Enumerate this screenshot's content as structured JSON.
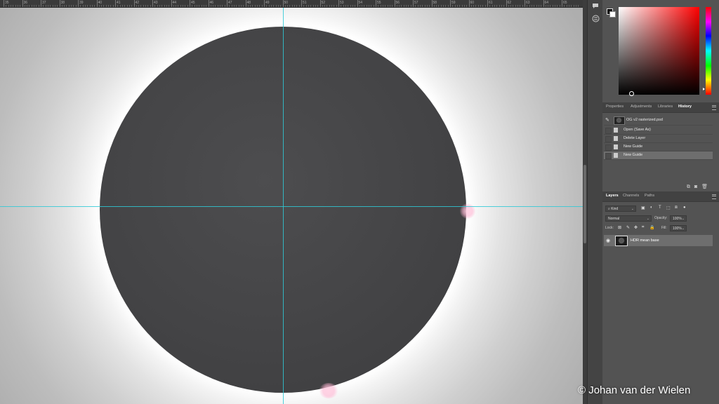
{
  "ruler": {
    "labels": [
      "35",
      "36",
      "37",
      "38",
      "39",
      "40",
      "41",
      "42",
      "43",
      "44",
      "45",
      "46",
      "47",
      "48",
      "49",
      "50",
      "51",
      "52",
      "53",
      "54",
      "55",
      "56",
      "57",
      "58",
      "59",
      "60",
      "61",
      "62",
      "63",
      "64",
      "65"
    ]
  },
  "color_panel": {
    "foreground_color": "#000000",
    "background_color": "#ffffff",
    "hue_color": "#ff0000"
  },
  "properties_tabs": [
    {
      "label": "Properties",
      "active": false
    },
    {
      "label": "Adjustments",
      "active": false
    },
    {
      "label": "Libraries",
      "active": false
    },
    {
      "label": "History",
      "active": true
    }
  ],
  "history": {
    "snapshot": "OG v2 rasterized.psd",
    "items": [
      {
        "label": "Open (Save As)",
        "selected": false
      },
      {
        "label": "Delete Layer",
        "selected": false
      },
      {
        "label": "New Guide",
        "selected": false
      },
      {
        "label": "New Guide",
        "selected": true
      }
    ]
  },
  "layers_tabs": [
    {
      "label": "Layers",
      "active": true
    },
    {
      "label": "Channels",
      "active": false
    },
    {
      "label": "Paths",
      "active": false
    }
  ],
  "layers": {
    "filter_kind": "Kind",
    "blend_mode": "Normal",
    "opacity_label": "Opacity:",
    "opacity_value": "100%",
    "lock_label": "Lock:",
    "fill_label": "Fill:",
    "fill_value": "100%",
    "items": [
      {
        "name": "HDR mean base",
        "visible": true
      }
    ]
  },
  "credit": "© Johan van der Wielen",
  "guide_color": "#2fc9d6"
}
